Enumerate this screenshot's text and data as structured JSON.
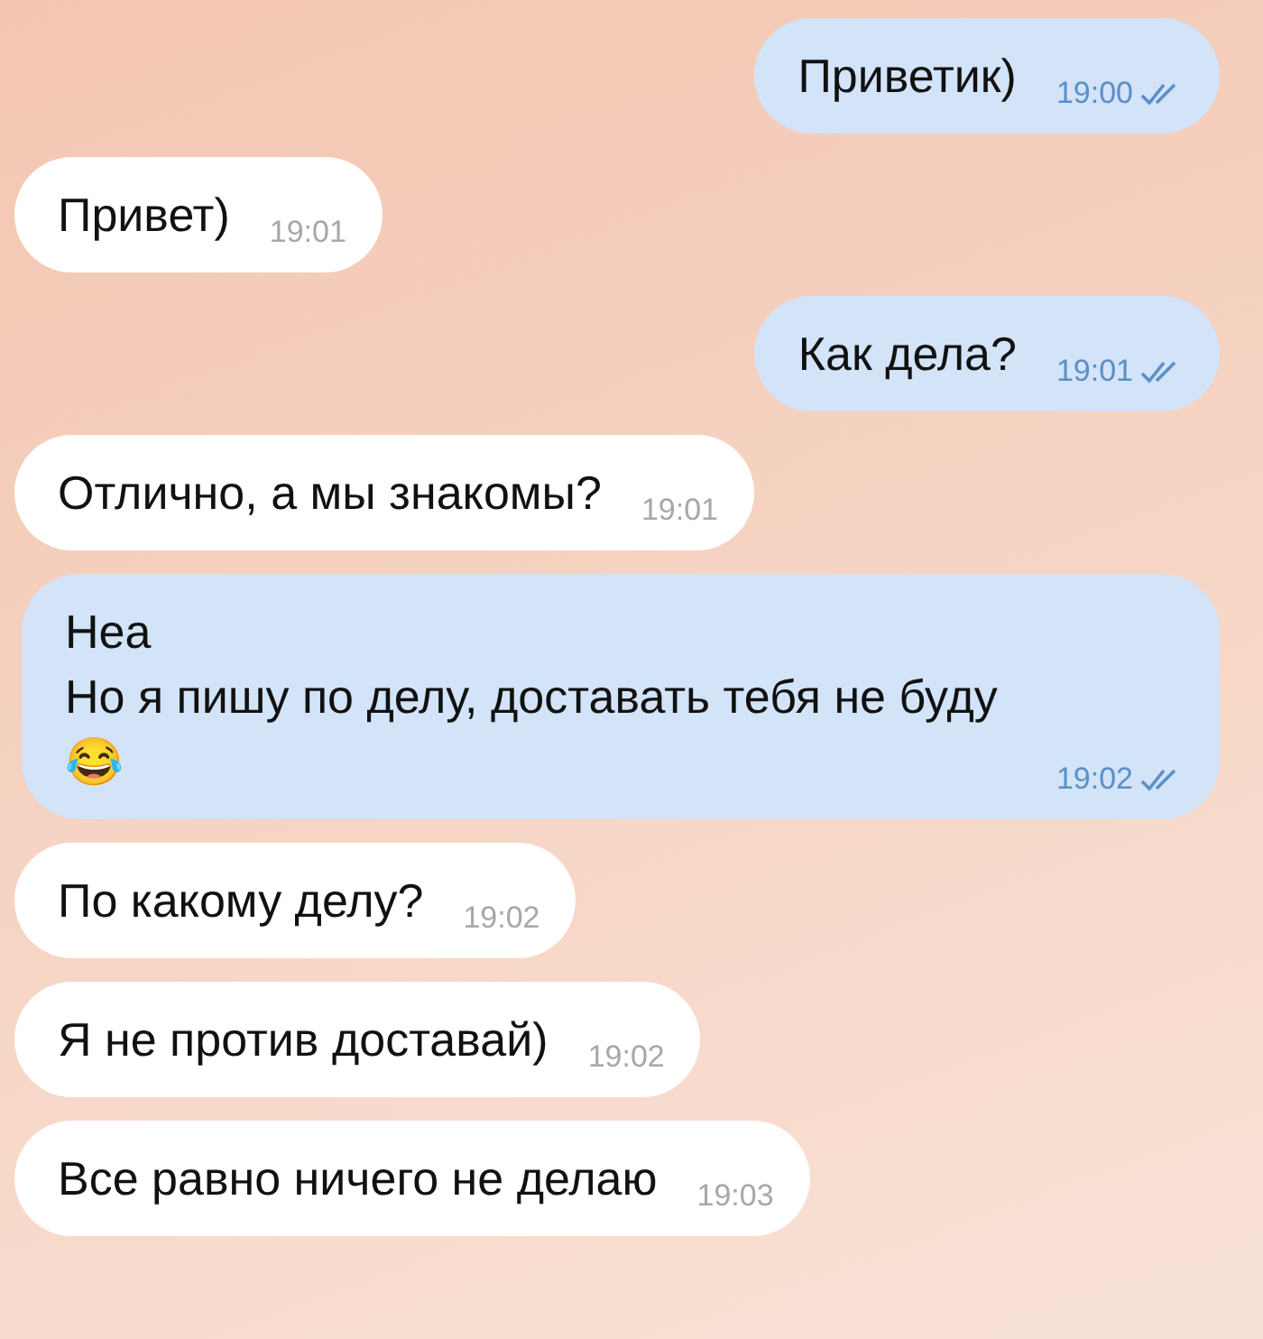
{
  "messages": [
    {
      "kind": "outgoing",
      "lines": [
        "Приветик)"
      ],
      "time": "19:00",
      "read": true
    },
    {
      "kind": "incoming",
      "lines": [
        "Привет)"
      ],
      "time": "19:01"
    },
    {
      "kind": "outgoing",
      "lines": [
        "Как дела?"
      ],
      "time": "19:01",
      "read": true
    },
    {
      "kind": "incoming",
      "lines": [
        "Отлично, а мы знакомы?"
      ],
      "time": "19:01"
    },
    {
      "kind": "outgoing",
      "lines": [
        "Неа",
        "Но я пишу по делу, доставать тебя не буду 😂"
      ],
      "time": "19:02",
      "read": true
    },
    {
      "kind": "incoming",
      "lines": [
        "По какому делу?"
      ],
      "time": "19:02"
    },
    {
      "kind": "incoming",
      "lines": [
        "Я не против доставай)"
      ],
      "time": "19:02"
    },
    {
      "kind": "incoming",
      "lines": [
        "Все равно ничего не делаю"
      ],
      "time": "19:03"
    }
  ]
}
